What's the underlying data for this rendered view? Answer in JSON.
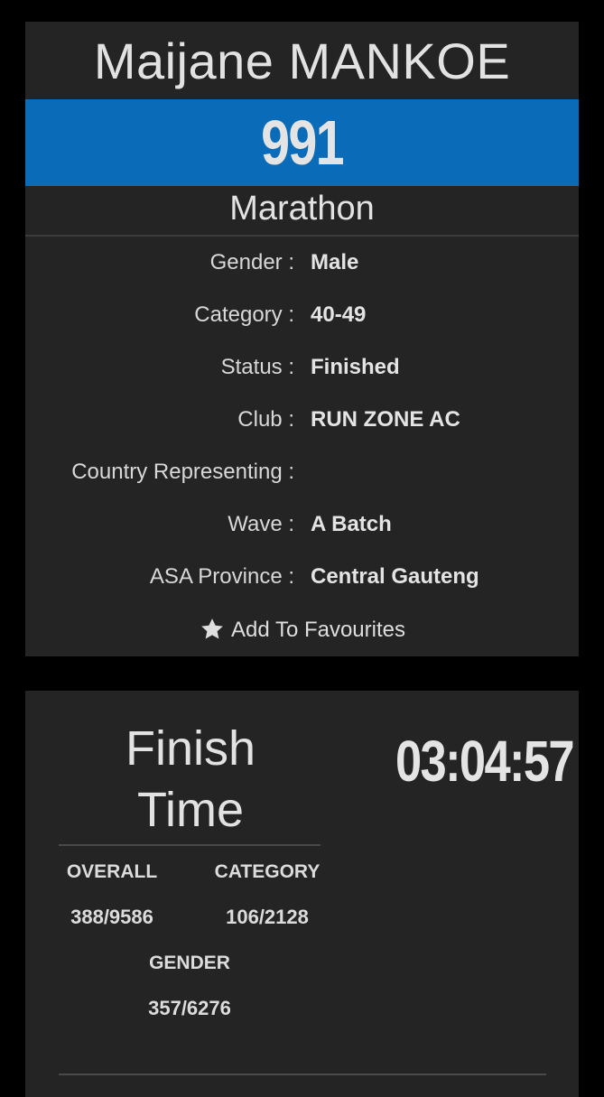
{
  "athlete": {
    "name": "Maijane MANKOE",
    "bib": "991",
    "race": "Marathon"
  },
  "details": [
    {
      "label": "Gender :",
      "value": "Male"
    },
    {
      "label": "Category :",
      "value": "40-49"
    },
    {
      "label": "Status :",
      "value": "Finished"
    },
    {
      "label": "Club :",
      "value": "RUN ZONE AC"
    },
    {
      "label": "Country Representing :",
      "value": ""
    },
    {
      "label": "Wave :",
      "value": "A Batch"
    },
    {
      "label": "ASA Province :",
      "value": "Central Gauteng"
    }
  ],
  "favourite": {
    "label": "Add To Favourites",
    "icon": "star-icon"
  },
  "result": {
    "finish_line1": "Finish",
    "finish_line2": "Time",
    "time": "03:04:57",
    "overall_label": "OVERALL",
    "overall_value": "388/9586",
    "category_label": "CATEGORY",
    "category_value": "106/2128",
    "gender_label": "GENDER",
    "gender_value": "357/6276"
  },
  "colors": {
    "background": "#000000",
    "card": "#242424",
    "bib_bar": "#0a6bb8",
    "text": "#e2e2e2"
  }
}
